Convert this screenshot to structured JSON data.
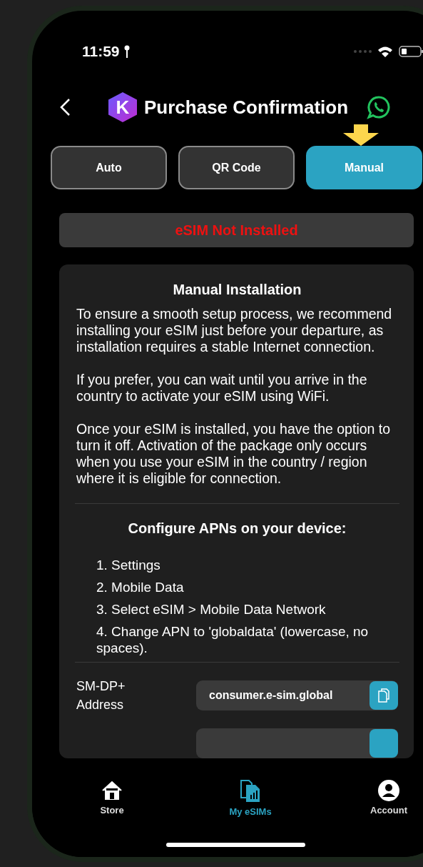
{
  "status_bar": {
    "time": "11:59"
  },
  "header": {
    "logo_letter": "K",
    "title": "Purchase Confirmation"
  },
  "tabs": [
    {
      "label": "Auto",
      "selected": false
    },
    {
      "label": "QR Code",
      "selected": false
    },
    {
      "label": "Manual",
      "selected": true
    }
  ],
  "status_banner": {
    "text": "eSIM Not Installed"
  },
  "card": {
    "title": "Manual Installation",
    "paragraphs": [
      "To ensure a smooth setup process, we recommend installing your eSIM just before your departure, as installation requires a stable Internet connection.",
      "If you prefer, you can wait until you arrive in the country to activate your eSIM using WiFi.",
      "Once your eSIM is installed, you have the option to turn it off. Activation of the package only occurs when you use your eSIM in the country / region where it is eligible for connection."
    ],
    "apn_title": "Configure APNs on your device:",
    "apn_steps": [
      "1. Settings",
      "2. Mobile Data",
      "3. Select eSIM > Mobile Data Network",
      "4. Change APN to 'globaldata' (lowercase, no spaces)."
    ],
    "fields": [
      {
        "label": "SM-DP+ Address",
        "value": "consumer.e-sim.global"
      }
    ]
  },
  "nav": [
    {
      "kind": "home",
      "label": "Store",
      "selected": false
    },
    {
      "kind": "sim",
      "label": "My eSIMs",
      "selected": true
    },
    {
      "kind": "account",
      "label": "Account",
      "selected": false
    }
  ]
}
